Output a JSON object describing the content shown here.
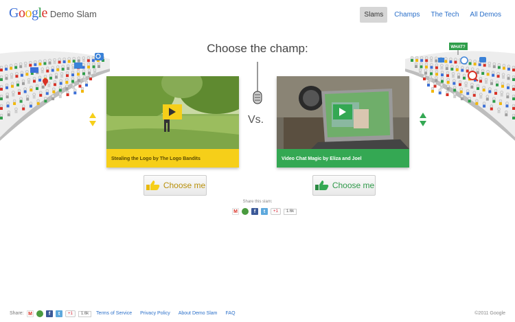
{
  "header": {
    "logo_text": "Google",
    "site_name": "Demo Slam",
    "nav": [
      {
        "label": "Slams",
        "active": true
      },
      {
        "label": "Champs",
        "active": false
      },
      {
        "label": "The Tech",
        "active": false
      },
      {
        "label": "All Demos",
        "active": false
      }
    ]
  },
  "stadium": {
    "sign_text": "WHAT?"
  },
  "main": {
    "title": "Choose the champ:",
    "vs_text": "Vs.",
    "left": {
      "caption": "Stealing the Logo by The Logo Bandits",
      "button_label": "Choose me",
      "color": "#f6cf19"
    },
    "right": {
      "caption": "Video Chat Magic by Eliza and Joel",
      "button_label": "Choose me",
      "color": "#34a853"
    }
  },
  "share": {
    "label": "Share this slam:",
    "gplus_label": "+1",
    "count": "1.6k",
    "icons": [
      "gmail-icon",
      "buzz-icon",
      "facebook-icon",
      "twitter-icon"
    ]
  },
  "footer": {
    "share_label": "Share:",
    "gplus_label": "+1",
    "count": "1.6k",
    "links": [
      "Terms of Service",
      "Privacy Policy",
      "About Demo Slam",
      "FAQ"
    ],
    "copyright": "©2011 Google"
  }
}
